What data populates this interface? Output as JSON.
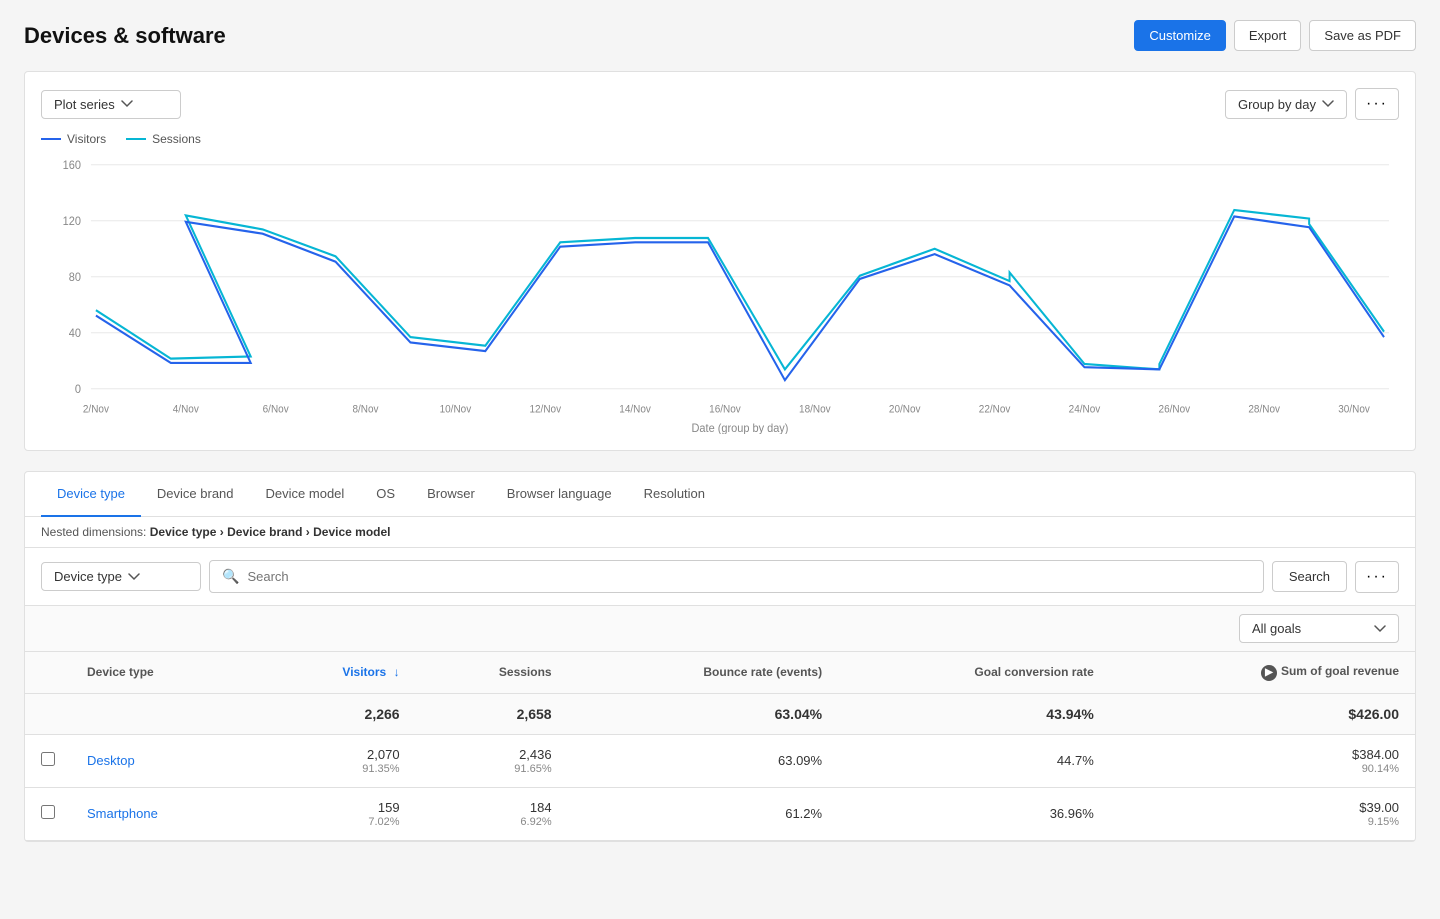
{
  "header": {
    "title": "Devices & software",
    "buttons": {
      "customize": "Customize",
      "export": "Export",
      "save_pdf": "Save as PDF"
    }
  },
  "chart": {
    "plot_series_label": "Plot series",
    "group_by_label": "Group by day",
    "legend": {
      "visitors": "Visitors",
      "sessions": "Sessions"
    },
    "x_axis_label": "Date (group by day)",
    "x_ticks": [
      "2/Nov",
      "4/Nov",
      "6/Nov",
      "8/Nov",
      "10/Nov",
      "12/Nov",
      "14/Nov",
      "16/Nov",
      "18/Nov",
      "20/Nov",
      "22/Nov",
      "24/Nov",
      "26/Nov",
      "28/Nov",
      "30/Nov"
    ],
    "y_ticks": [
      "0",
      "40",
      "80",
      "120",
      "160"
    ]
  },
  "tabs": {
    "items": [
      {
        "label": "Device type",
        "active": true
      },
      {
        "label": "Device brand",
        "active": false
      },
      {
        "label": "Device model",
        "active": false
      },
      {
        "label": "OS",
        "active": false
      },
      {
        "label": "Browser",
        "active": false
      },
      {
        "label": "Browser language",
        "active": false
      },
      {
        "label": "Resolution",
        "active": false
      }
    ]
  },
  "nested_dimensions": {
    "prefix": "Nested dimensions:",
    "path": "Device type › Device brand › Device model"
  },
  "table_controls": {
    "dimension_select": "Device type",
    "search_placeholder": "Search",
    "search_button": "Search"
  },
  "goals_select": {
    "label": "All goals"
  },
  "table": {
    "headers": [
      {
        "key": "checkbox",
        "label": ""
      },
      {
        "key": "device_type",
        "label": "Device type"
      },
      {
        "key": "visitors",
        "label": "Visitors",
        "sorted": true,
        "sort_dir": "desc"
      },
      {
        "key": "sessions",
        "label": "Sessions"
      },
      {
        "key": "bounce_rate",
        "label": "Bounce rate (events)"
      },
      {
        "key": "goal_conversion",
        "label": "Goal conversion rate"
      },
      {
        "key": "goal_revenue",
        "label": "Sum of goal revenue",
        "info": true
      }
    ],
    "total_row": {
      "visitors": "2,266",
      "sessions": "2,658",
      "bounce_rate": "63.04%",
      "goal_conversion": "43.94%",
      "goal_revenue": "$426.00"
    },
    "rows": [
      {
        "device_type": "Desktop",
        "visitors_main": "2,070",
        "visitors_sub": "91.35%",
        "sessions_main": "2,436",
        "sessions_sub": "91.65%",
        "bounce_rate": "63.09%",
        "goal_conversion": "44.7%",
        "revenue_main": "$384.00",
        "revenue_sub": "90.14%"
      },
      {
        "device_type": "Smartphone",
        "visitors_main": "159",
        "visitors_sub": "7.02%",
        "sessions_main": "184",
        "sessions_sub": "6.92%",
        "bounce_rate": "61.2%",
        "goal_conversion": "36.96%",
        "revenue_main": "$39.00",
        "revenue_sub": "9.15%"
      }
    ]
  },
  "colors": {
    "primary": "#1a73e8",
    "visitors_line": "#2563eb",
    "sessions_line": "#06b6d4"
  }
}
